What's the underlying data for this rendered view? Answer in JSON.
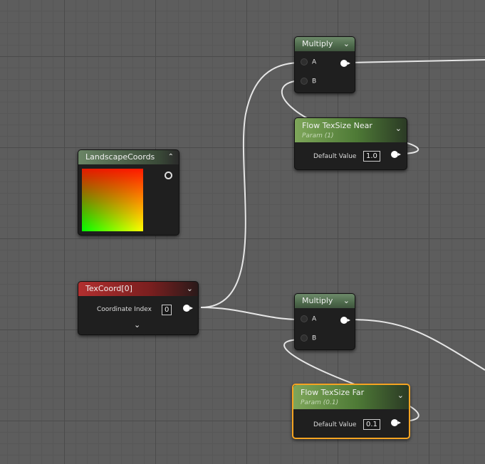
{
  "nodes": {
    "multiply_top": {
      "title": "Multiply",
      "pins": [
        "A",
        "B"
      ]
    },
    "flow_near": {
      "title": "Flow TexSize Near",
      "subtitle": "Param (1)",
      "field_label": "Default Value",
      "value": "1.0"
    },
    "landscape": {
      "title": "LandscapeCoords"
    },
    "texcoord": {
      "title": "TexCoord[0]",
      "field_label": "Coordinate Index",
      "value": "0"
    },
    "multiply_bottom": {
      "title": "Multiply",
      "pins": [
        "A",
        "B"
      ]
    },
    "flow_far": {
      "title": "Flow TexSize Far",
      "subtitle": "Param (0.1)",
      "field_label": "Default Value",
      "value": "0.1"
    }
  },
  "colors": {
    "wire": "#e6e6e6",
    "selection": "#f5a422",
    "param_header": "#5e8a42",
    "texcoord_header": "#a02a2a"
  }
}
